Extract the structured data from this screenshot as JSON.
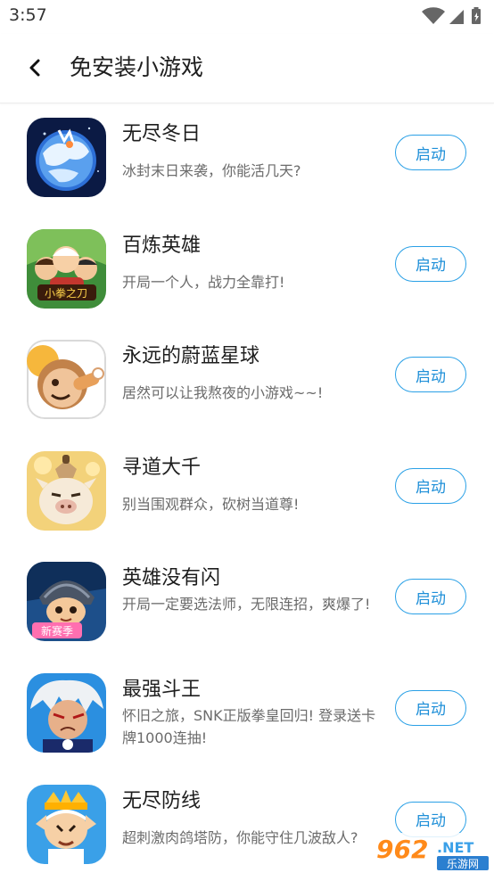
{
  "status_bar": {
    "time": "3:57"
  },
  "header": {
    "title": "免安装小游戏"
  },
  "games": [
    {
      "name": "无尽冬日",
      "desc": "冰封末日来袭，你能活几天?",
      "button": "启动",
      "icon": "frozen-planet-icon"
    },
    {
      "name": "百炼英雄",
      "desc": "开局一个人，战力全靠打!",
      "button": "启动",
      "icon": "heroes-group-icon"
    },
    {
      "name": "永远的蔚蓝星球",
      "desc": "居然可以让我熬夜的小游戏~~!",
      "button": "启动",
      "icon": "caveman-eating-icon"
    },
    {
      "name": "寻道大千",
      "desc": "别当围观群众，砍树当道尊!",
      "button": "启动",
      "icon": "pig-character-icon"
    },
    {
      "name": "英雄没有闪",
      "desc": "开局一定要选法师，无限连招，爽爆了!",
      "button": "启动",
      "icon": "helmet-hero-icon",
      "badge": "新赛季"
    },
    {
      "name": "最强斗王",
      "desc": "怀旧之旅，SNK正版拳皇回归! 登录送卡牌1000连抽!",
      "button": "启动",
      "icon": "white-hair-fighter-icon"
    },
    {
      "name": "无尽防线",
      "desc": "超刺激肉鸽塔防，你能守住几波敌人?",
      "button": "启动",
      "icon": "crowned-elf-icon"
    }
  ],
  "watermark": {
    "number": "962",
    "suffix": ".NET",
    "sub": "乐游网"
  },
  "colors": {
    "accent": "#2aa0e6",
    "title": "#1f1f1f",
    "desc": "#6b6b6b"
  }
}
